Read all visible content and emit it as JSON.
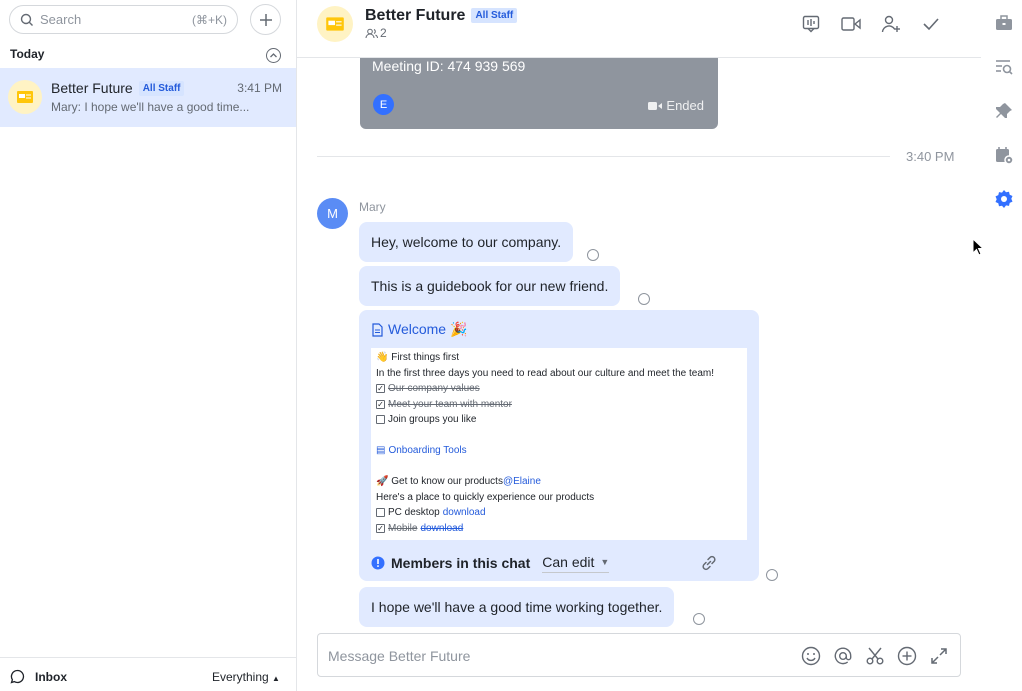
{
  "left": {
    "search_placeholder": "Search",
    "search_shortcut": "(⌘+K)",
    "section_label": "Today",
    "conversation": {
      "name": "Better Future",
      "tag": "All Staff",
      "time": "3:41 PM",
      "preview": "Mary: I hope we'll have a good time..."
    },
    "footer": {
      "inbox": "Inbox",
      "filter": "Everything"
    }
  },
  "header": {
    "title": "Better Future",
    "tag": "All Staff",
    "member_count": "2"
  },
  "meeting": {
    "meeting_id": "Meeting ID: 474 939 569",
    "initial": "E",
    "status": "Ended"
  },
  "divider_time": "3:40 PM",
  "message_group": {
    "avatar_initial": "M",
    "sender": "Mary",
    "messages": [
      "Hey, welcome to our company.",
      "This is a guidebook for our new friend.",
      "I hope we'll have a good time working together."
    ]
  },
  "doc_card": {
    "title": "Welcome 🎉",
    "lines": {
      "l1": "👋 First things first",
      "l2": "In the first three days you need to read about our culture and meet the team!",
      "l3": "Our company values",
      "l4": "Meet your team with mentor",
      "l5": "Join groups you like",
      "l6": "Onboarding Tools",
      "l7": "🚀 Get to know our products",
      "l7_mention": "@Elaine",
      "l8": "Here's a place to quickly experience our products",
      "l9": "PC desktop",
      "l9_link": "download",
      "l10": "Mobile",
      "l10_link": "download"
    },
    "members_label": "Members in this chat",
    "permission": "Can edit"
  },
  "composer": {
    "placeholder": "Message Better Future"
  },
  "colors": {
    "accent": "#3370ff",
    "bubble": "#e1eaff",
    "meeting_card": "#8f959e",
    "avatar_yellow": "#fff3c4"
  }
}
